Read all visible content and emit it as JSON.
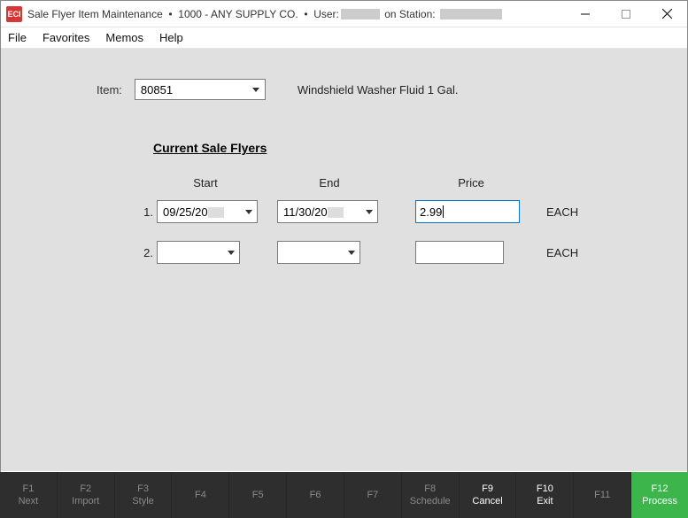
{
  "titlebar": {
    "app_icon_text": "ECI",
    "pre_user": "Sale Flyer Item Maintenance  •  1000 - ANY SUPPLY CO.  •  User:",
    "on_station": " on Station: "
  },
  "menu": {
    "file": "File",
    "favorites": "Favorites",
    "memos": "Memos",
    "help": "Help"
  },
  "item": {
    "label": "Item:",
    "value": "80851",
    "description": "Windshield Washer Fluid 1 Gal."
  },
  "section": {
    "header": "Current Sale Flyers",
    "col_start": "Start",
    "col_end": "End",
    "col_price": "Price"
  },
  "rows": {
    "r1": {
      "num": "1.",
      "start": "09/25/20",
      "end": "11/30/20",
      "price": "2.99",
      "uom": "EACH"
    },
    "r2": {
      "num": "2.",
      "start": "",
      "end": "",
      "price": "",
      "uom": "EACH"
    }
  },
  "fkeys": {
    "f1": {
      "key": "F1",
      "label": "Next"
    },
    "f2": {
      "key": "F2",
      "label": "Import"
    },
    "f3": {
      "key": "F3",
      "label": "Style"
    },
    "f4": {
      "key": "F4",
      "label": ""
    },
    "f5": {
      "key": "F5",
      "label": ""
    },
    "f6": {
      "key": "F6",
      "label": ""
    },
    "f7": {
      "key": "F7",
      "label": ""
    },
    "f8": {
      "key": "F8",
      "label": "Schedule"
    },
    "f9": {
      "key": "F9",
      "label": "Cancel"
    },
    "f10": {
      "key": "F10",
      "label": "Exit"
    },
    "f11": {
      "key": "F11",
      "label": ""
    },
    "f12": {
      "key": "F12",
      "label": "Process"
    }
  }
}
